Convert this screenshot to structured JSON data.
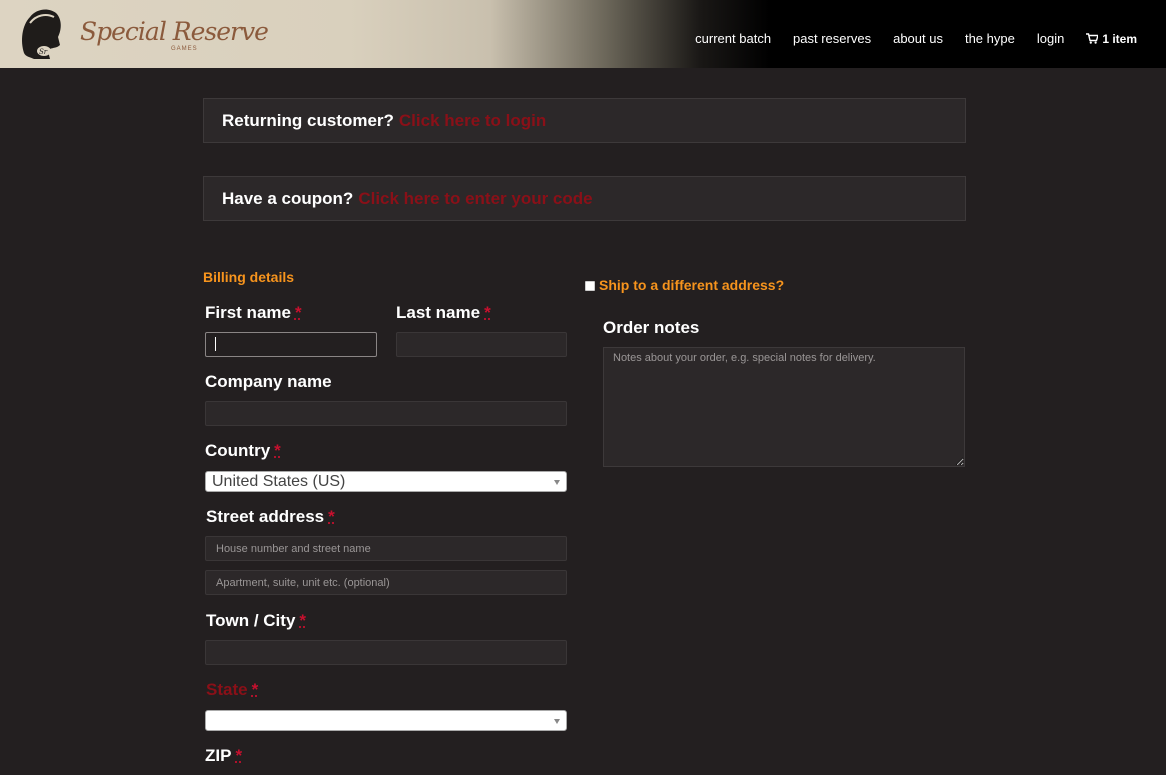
{
  "brand": {
    "name": "Special Reserve",
    "sub": "GAMES"
  },
  "nav": {
    "items": [
      {
        "label": "current batch"
      },
      {
        "label": "past reserves"
      },
      {
        "label": "about us"
      },
      {
        "label": "the hype"
      },
      {
        "label": "login"
      }
    ],
    "cart_label": "1 item"
  },
  "notices": {
    "login": {
      "text": "Returning customer?",
      "link": "Click here to login"
    },
    "coupon": {
      "text": "Have a coupon?",
      "link": "Click here to enter your code"
    }
  },
  "billing": {
    "title": "Billing details",
    "required_mark": "*",
    "first_name": {
      "label": "First name",
      "value": ""
    },
    "last_name": {
      "label": "Last name",
      "value": ""
    },
    "company": {
      "label": "Company name",
      "value": ""
    },
    "country": {
      "label": "Country",
      "value": "United States (US)"
    },
    "street": {
      "label": "Street address",
      "placeholder1": "House number and street name",
      "placeholder2": "Apartment, suite, unit etc. (optional)"
    },
    "city": {
      "label": "Town / City",
      "value": ""
    },
    "state": {
      "label": "State",
      "value": ""
    },
    "zip": {
      "label": "ZIP"
    }
  },
  "shipping": {
    "label": "Ship to a different address?",
    "checked": false
  },
  "order_notes": {
    "label": "Order notes",
    "placeholder": "Notes about your order, e.g. special notes for delivery."
  },
  "colors": {
    "accent": "#f7941d",
    "link": "#8a1018",
    "required": "#c8102e",
    "bg": "#231f20"
  }
}
